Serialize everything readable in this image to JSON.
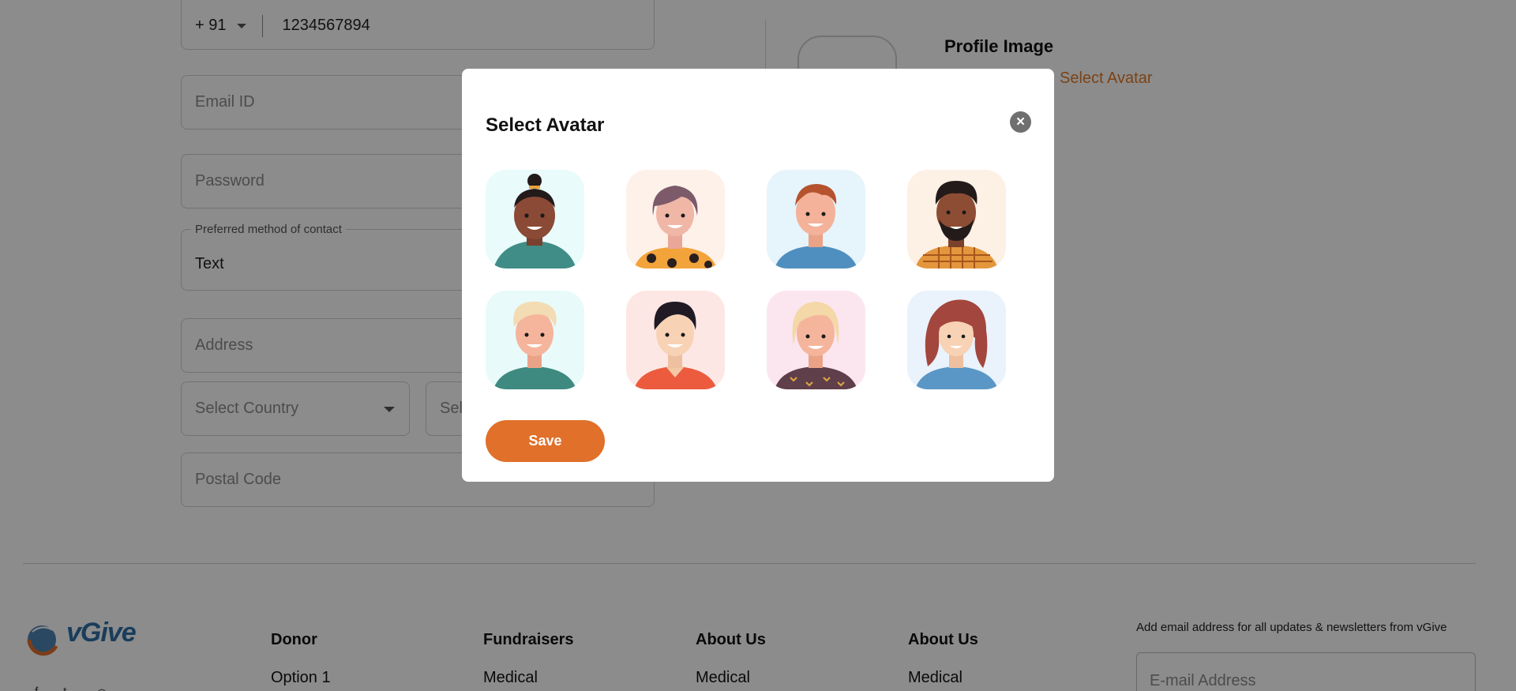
{
  "form": {
    "phone": {
      "country_code": "+ 91",
      "number": "1234567894"
    },
    "email": {
      "placeholder": "Email ID"
    },
    "password": {
      "placeholder": "Password"
    },
    "contact_method": {
      "label": "Preferred method of contact",
      "value": "Text"
    },
    "address": {
      "placeholder": "Address"
    },
    "country": {
      "placeholder": "Select Country"
    },
    "state": {
      "placeholder": "Sel"
    },
    "postal_code": {
      "placeholder": "Postal Code"
    }
  },
  "profile": {
    "title": "Profile Image",
    "select_link": "Select Avatar"
  },
  "modal": {
    "title": "Select Avatar",
    "close_icon": "close-icon",
    "save_label": "Save",
    "avatars": [
      {
        "name": "avatar-1",
        "bg": "#e9fbfb"
      },
      {
        "name": "avatar-2",
        "bg": "#fdf1ea"
      },
      {
        "name": "avatar-3",
        "bg": "#e6f4fb"
      },
      {
        "name": "avatar-4",
        "bg": "#fdf0e4"
      },
      {
        "name": "avatar-5",
        "bg": "#e8fbfa"
      },
      {
        "name": "avatar-6",
        "bg": "#fde7e5"
      },
      {
        "name": "avatar-7",
        "bg": "#fbe6ef"
      },
      {
        "name": "avatar-8",
        "bg": "#eaf2fb"
      }
    ]
  },
  "footer": {
    "logo_text": "vGive",
    "columns": [
      {
        "title": "Donor",
        "first_item": "Option 1"
      },
      {
        "title": "Fundraisers",
        "first_item": "Medical"
      },
      {
        "title": "About Us",
        "first_item": "Medical"
      },
      {
        "title": "About Us",
        "first_item": "Medical"
      }
    ],
    "newsletter_text": "Add email address for all updates & newsletters from vGive",
    "email_placeholder": "E-mail Address",
    "social_icons": [
      "facebook-icon",
      "twitter-icon",
      "instagram-icon"
    ]
  },
  "colors": {
    "accent": "#e0702a",
    "overlay": "rgba(0,0,0,0.45)"
  }
}
